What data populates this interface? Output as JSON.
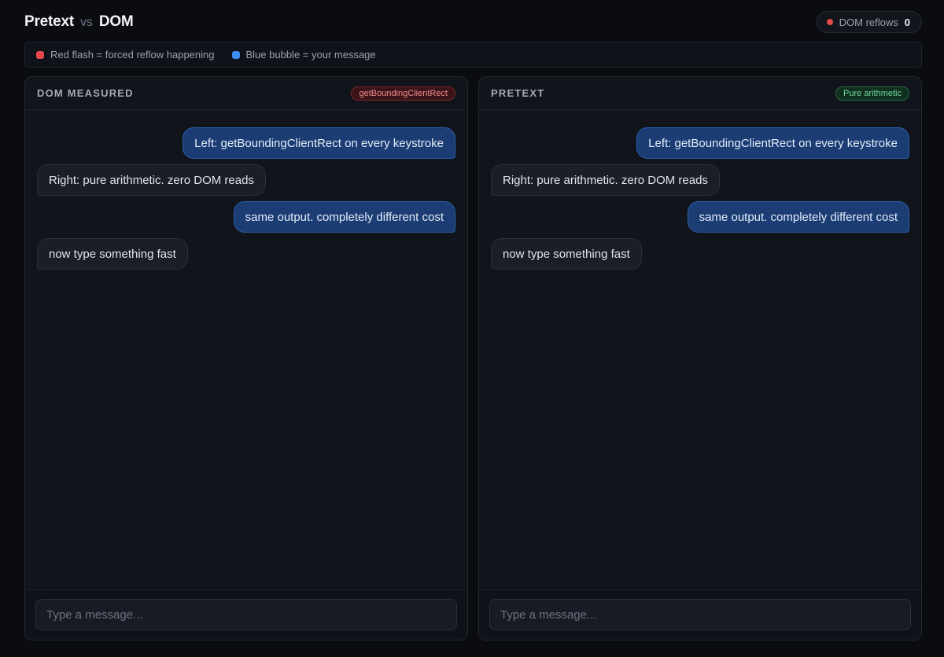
{
  "header": {
    "title_left": "Pretext",
    "title_vs": "vs",
    "title_right": "DOM",
    "reflow_label": "DOM reflows",
    "reflow_count": "0"
  },
  "legend": {
    "items": [
      {
        "label": "Red flash = forced reflow happening",
        "color": "#e5484d"
      },
      {
        "label": "Blue bubble = your message",
        "color": "#3b8cf0"
      }
    ]
  },
  "panels": {
    "left": {
      "title": "DOM MEASURED",
      "tag": "getBoundingClientRect",
      "messages": [
        {
          "side": "out",
          "text": "Left: getBoundingClientRect on every keystroke"
        },
        {
          "side": "in",
          "text": "Right: pure arithmetic. zero DOM reads"
        },
        {
          "side": "out",
          "text": "same output. completely different cost"
        },
        {
          "side": "in",
          "text": "now type something fast"
        }
      ],
      "input_placeholder": "Type a message...",
      "input_value": ""
    },
    "right": {
      "title": "PRETEXT",
      "tag": "Pure arithmetic",
      "messages": [
        {
          "side": "out",
          "text": "Left: getBoundingClientRect on every keystroke"
        },
        {
          "side": "in",
          "text": "Right: pure arithmetic. zero DOM reads"
        },
        {
          "side": "out",
          "text": "same output. completely different cost"
        },
        {
          "side": "in",
          "text": "now type something fast"
        }
      ],
      "input_placeholder": "Type a message...",
      "input_value": ""
    }
  }
}
